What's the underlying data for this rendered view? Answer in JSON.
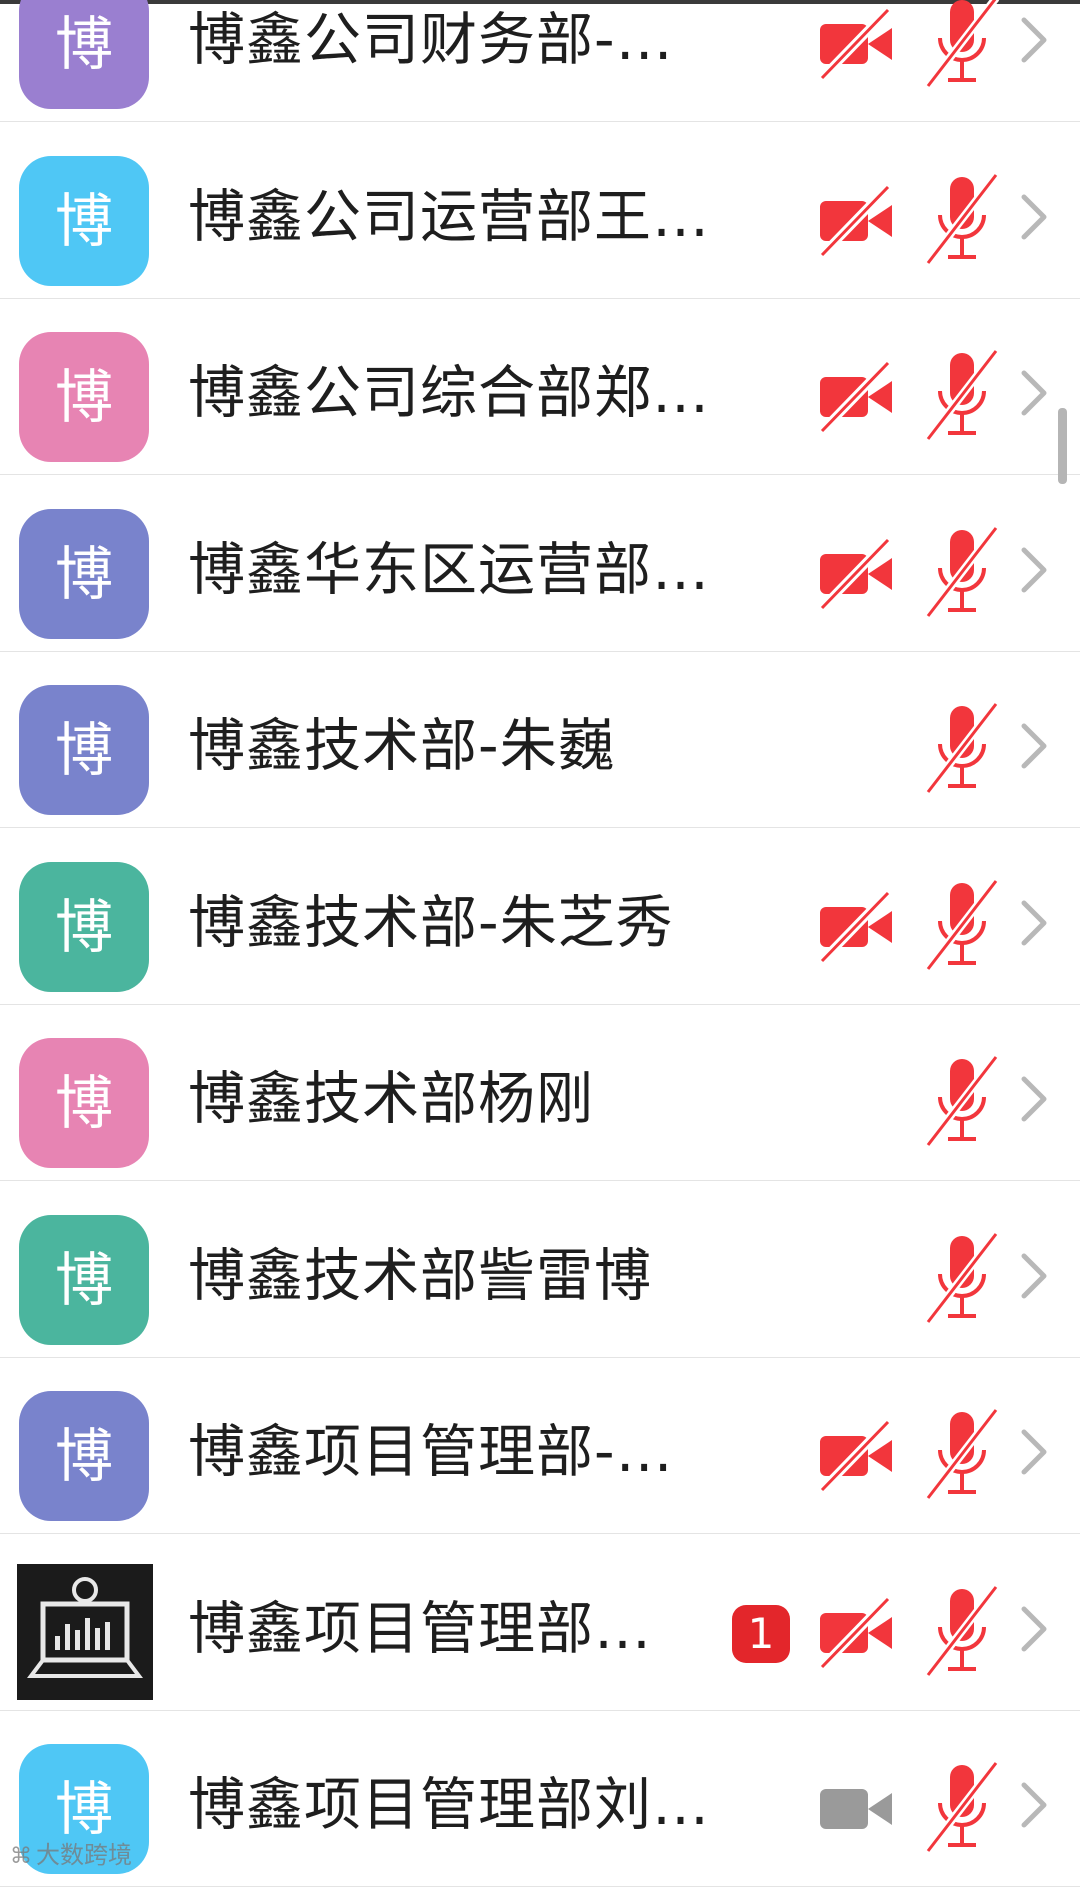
{
  "colors": {
    "purple": "#9a7fd0",
    "blue": "#4fc7f5",
    "pink": "#e784b3",
    "indigo": "#7983cc",
    "teal": "#4bb59e",
    "alert_red": "#f2363c",
    "inactive_gray": "#9a9a9a"
  },
  "participants": [
    {
      "avatar_text": "博",
      "avatar_color": "purple",
      "name": "博鑫公司财务部-…",
      "camera": "off",
      "mic": "muted",
      "badge": ""
    },
    {
      "avatar_text": "博",
      "avatar_color": "blue",
      "name": "博鑫公司运营部王…",
      "camera": "off",
      "mic": "muted",
      "badge": ""
    },
    {
      "avatar_text": "博",
      "avatar_color": "pink",
      "name": "博鑫公司综合部郑…",
      "camera": "off",
      "mic": "muted",
      "badge": ""
    },
    {
      "avatar_text": "博",
      "avatar_color": "indigo",
      "name": "博鑫华东区运营部…",
      "camera": "off",
      "mic": "muted",
      "badge": ""
    },
    {
      "avatar_text": "博",
      "avatar_color": "indigo",
      "name": "博鑫技术部-朱巍",
      "camera": "none",
      "mic": "muted",
      "badge": ""
    },
    {
      "avatar_text": "博",
      "avatar_color": "teal",
      "name": "博鑫技术部-朱芝秀",
      "camera": "off",
      "mic": "muted",
      "badge": ""
    },
    {
      "avatar_text": "博",
      "avatar_color": "pink",
      "name": "博鑫技术部杨刚",
      "camera": "none",
      "mic": "muted",
      "badge": ""
    },
    {
      "avatar_text": "博",
      "avatar_color": "teal",
      "name": "博鑫技术部訾雷博",
      "camera": "none",
      "mic": "muted",
      "badge": ""
    },
    {
      "avatar_text": "博",
      "avatar_color": "indigo",
      "name": "博鑫项目管理部-…",
      "camera": "off",
      "mic": "muted",
      "badge": ""
    },
    {
      "avatar_text": "",
      "avatar_color": "device",
      "name": "博鑫项目管理部…",
      "camera": "off",
      "mic": "muted",
      "badge": "1"
    },
    {
      "avatar_text": "博",
      "avatar_color": "blue",
      "name": "博鑫项目管理部刘…",
      "camera": "inactive",
      "mic": "muted",
      "badge": ""
    }
  ],
  "watermark": {
    "text": "大数跨境",
    "icon": "watermark-logo-icon"
  }
}
